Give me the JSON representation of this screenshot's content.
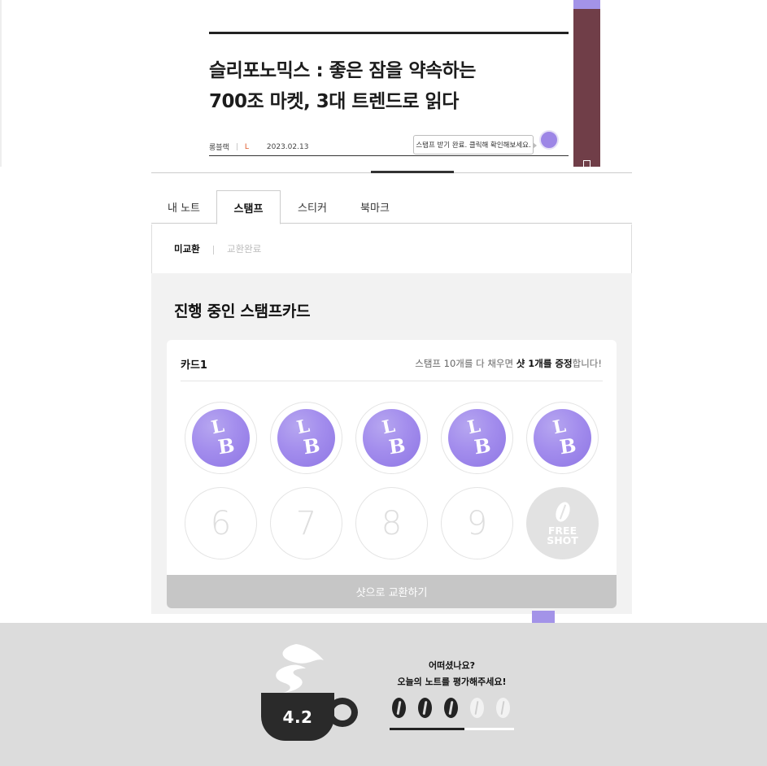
{
  "article": {
    "title_line1": "슬리포노믹스 : 좋은 잠을 약속하는",
    "title_line2": "700조 마켓, 3대 트렌드로 읽다",
    "author": "롱블랙",
    "category": "L",
    "date": "2023.02.13",
    "stamp_tooltip": "스탬프 받기 완료. 클릭해 확인해보세요."
  },
  "tabs": [
    {
      "label": "내 노트",
      "active": false
    },
    {
      "label": "스탬프",
      "active": true
    },
    {
      "label": "스티커",
      "active": false
    },
    {
      "label": "북마크",
      "active": false
    }
  ],
  "subtabs": [
    {
      "label": "미교환",
      "active": true
    },
    {
      "label": "교환완료",
      "active": false
    }
  ],
  "section_title": "진행 중인 스탬프카드",
  "card": {
    "name": "카드1",
    "note_prefix": "스탬프 10개를 다 채우면 ",
    "note_bold": "샷 1개를 증정",
    "note_suffix": "합니다!",
    "stamp_letters": [
      "L",
      "B"
    ],
    "empty_slots": [
      "6",
      "7",
      "8",
      "9"
    ],
    "free_shot_line1": "FREE",
    "free_shot_line2": "SHOT",
    "redeem_label": "샷으로 교환하기",
    "stamps_collected": 5,
    "stamps_total": 10
  },
  "rating": {
    "score": "4.2",
    "question_line1": "어떠셨나요?",
    "question_line2": "오늘의 노트를 평가해주세요!",
    "beans_filled": 3,
    "beans_total": 5,
    "progress_fraction": 0.6
  },
  "colors": {
    "stamp_purple": "#a38ded",
    "sidebar_maroon": "#703e48",
    "accent_purple": "#a393e8",
    "footer_gray": "#dcdcdc",
    "redeem_gray": "#c6c6c6",
    "category_orange": "#e05a2a"
  },
  "icons": [
    "stamp-icon",
    "coffee-bean-icon",
    "coffee-cup-icon",
    "steam-icon",
    "bookmark-icon"
  ]
}
